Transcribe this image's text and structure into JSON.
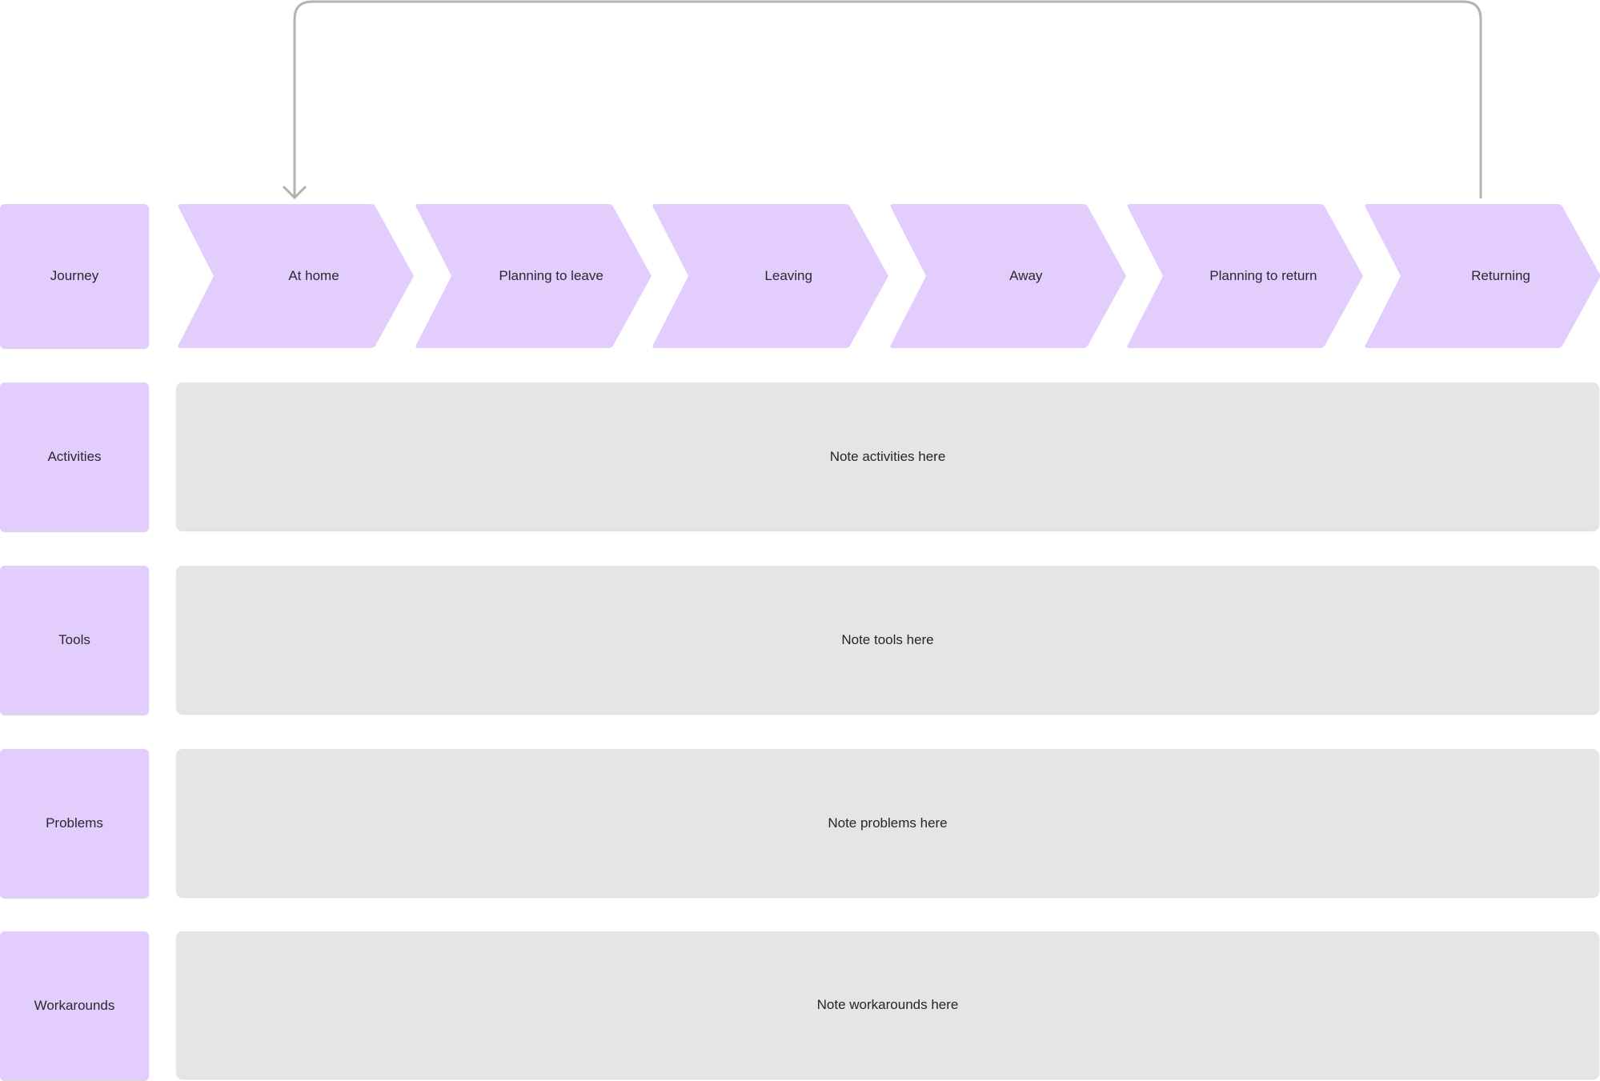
{
  "rows": {
    "journey": {
      "label": "Journey"
    },
    "activities": {
      "label": "Activities",
      "note": "Note activities here"
    },
    "tools": {
      "label": "Tools",
      "note": "Note tools here"
    },
    "problems": {
      "label": "Problems",
      "note": "Note problems here"
    },
    "workarounds": {
      "label": "Workarounds",
      "note": "Note workarounds here"
    }
  },
  "stages": [
    "At home",
    "Planning to leave",
    "Leaving",
    "Away",
    "Planning to return",
    "Returning"
  ],
  "connector": {
    "from": "Returning",
    "to": "At home"
  },
  "colors": {
    "label_fill": "#e3cdfd",
    "note_fill": "#e5e5e5",
    "connector": "#b3b3b3",
    "text": "#2b2833"
  }
}
